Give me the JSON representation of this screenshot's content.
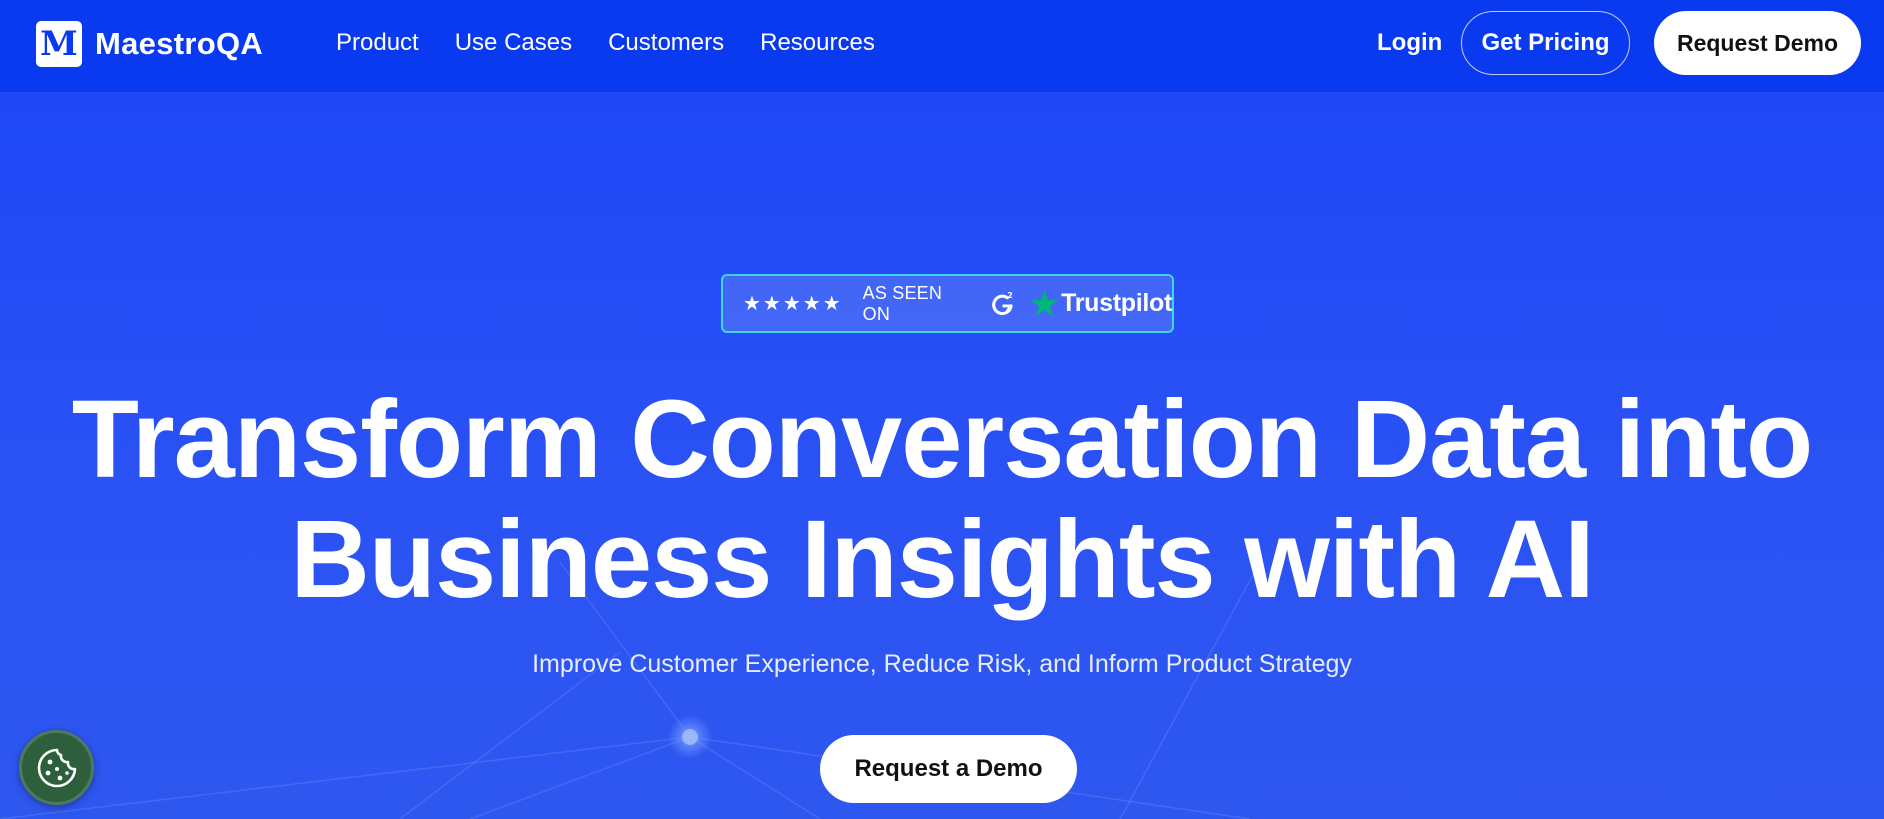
{
  "brand": {
    "logo_letter": "M",
    "name": "MaestroQA"
  },
  "nav": {
    "links": [
      "Product",
      "Use Cases",
      "Customers",
      "Resources"
    ],
    "login": "Login",
    "get_pricing": "Get Pricing",
    "request_demo": "Request Demo"
  },
  "badge": {
    "stars": "★★★★★",
    "as_seen_on": "AS SEEN ON",
    "trustpilot": "Trustpilot"
  },
  "hero": {
    "headline_line1": "Transform Conversation Data into",
    "headline_line2": "Business Insights with AI",
    "subheadline": "Improve Customer Experience, Reduce Risk, and Inform Product Strategy",
    "cta": "Request a Demo"
  },
  "icons": {
    "g2": "g2-icon",
    "trustpilot_star": "trustpilot-star-icon",
    "cookie": "cookie-icon"
  },
  "colors": {
    "nav_bg": "#0a3af0",
    "hero_bg": "#2a4ff6",
    "badge_border": "#3fd6ea",
    "trustpilot_green": "#00b67a",
    "cookie_bg": "#2e5f3c"
  }
}
